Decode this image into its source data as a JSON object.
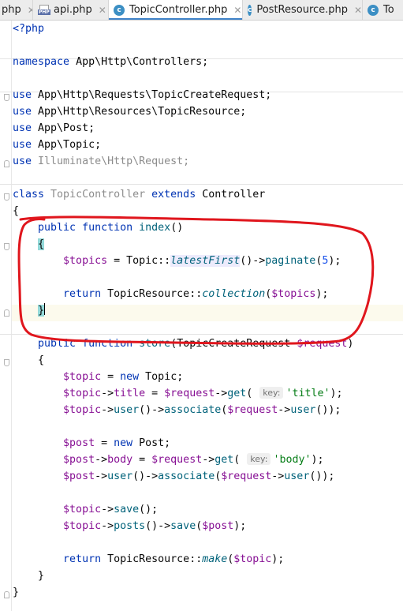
{
  "tabs": [
    {
      "label": "php",
      "active": false,
      "icon": "none"
    },
    {
      "label": "api.php",
      "active": false,
      "icon": "php-file-icon"
    },
    {
      "label": "TopicController.php",
      "active": true,
      "icon": "class-c-icon"
    },
    {
      "label": "PostResource.php",
      "active": false,
      "icon": "class-c-icon"
    },
    {
      "label": "To",
      "active": false,
      "icon": "class-c-icon"
    }
  ],
  "tab_close_glyph": "✕",
  "class_icon_letter": "c",
  "php_icon_label": "PHP",
  "code": {
    "l1": "<?php",
    "l3_kw": "namespace",
    "l3_rest": " App\\Http\\Controllers;",
    "use_kw": "use",
    "l5": " App\\Http\\Requests\\TopicCreateRequest;",
    "l6": " App\\Http\\Resources\\TopicResource;",
    "l7": " App\\Post;",
    "l8": " App\\Topic;",
    "l9": " Illuminate\\Http\\Request;",
    "class_kw": "class",
    "class_name": "TopicController",
    "extends_kw": "extends",
    "parent": "Controller",
    "open_brace": "{",
    "close_brace": "}",
    "public_kw": "public",
    "function_kw": "function",
    "index_name": "index",
    "index_parens": "()",
    "topics_var": "$topics",
    "assign": " = ",
    "topic_class": "Topic",
    "scope_op": "::",
    "latest_first": "latestFirst",
    "arrow_call": "()->",
    "paginate": "paginate",
    "paginate_arg": "5",
    "paren_semicolon": ");",
    "return_kw": "return",
    "topic_resource": "TopicResource",
    "collection": "collection",
    "store_name": "store",
    "store_param_type": "TopicCreateRequest",
    "request_var": "$request",
    "topic_var": "$topic",
    "new_kw": "new",
    "topic_semicolon": "Topic;",
    "title_prop": "title",
    "get_method": "get",
    "hint_key": "key:",
    "title_str": "'title'",
    "user_method": "user",
    "associate_method": "associate",
    "post_var": "$post",
    "post_semicolon": "Post;",
    "body_prop": "body",
    "body_str": "'body'",
    "save_method": "save",
    "posts_method": "posts",
    "make_method": "make"
  },
  "colors": {
    "keyword": "#0033b3",
    "variable": "#871094",
    "method": "#00627a",
    "string": "#067d17",
    "number": "#1750eb",
    "unused": "#8c8c8c",
    "annotation_loop": "#e0161d"
  }
}
